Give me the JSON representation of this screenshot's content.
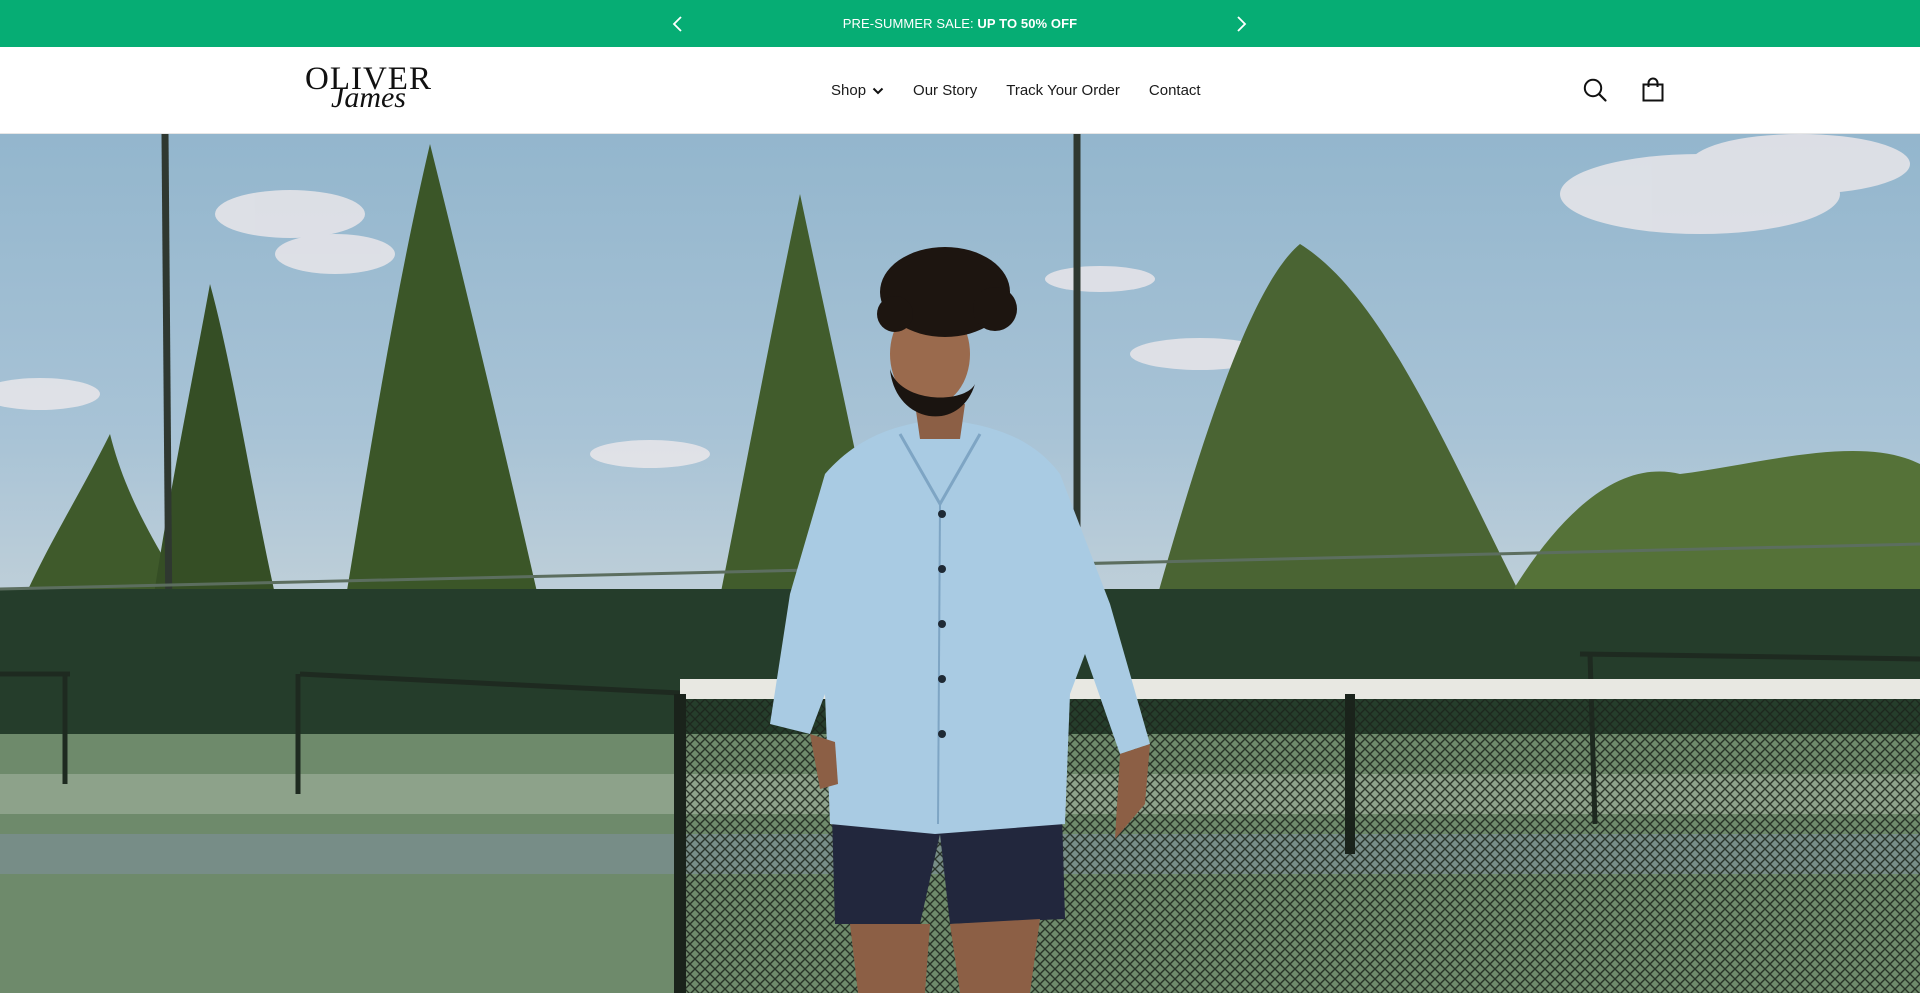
{
  "announcement": {
    "prefix": "PRE-SUMMER SALE:",
    "highlight": "UP TO 50% OFF",
    "prev_icon": "chevron-left-icon",
    "next_icon": "chevron-right-icon",
    "background": "#06ad74"
  },
  "header": {
    "logo_line1": "OLIVER",
    "logo_line2": "James",
    "nav": [
      {
        "label": "Shop",
        "has_dropdown": true
      },
      {
        "label": "Our Story"
      },
      {
        "label": "Track Your Order"
      },
      {
        "label": "Contact"
      }
    ],
    "icons": [
      "search-icon",
      "shopping-bag-icon"
    ]
  },
  "hero": {
    "image": "man-in-light-blue-shirt-on-tennis-court"
  }
}
